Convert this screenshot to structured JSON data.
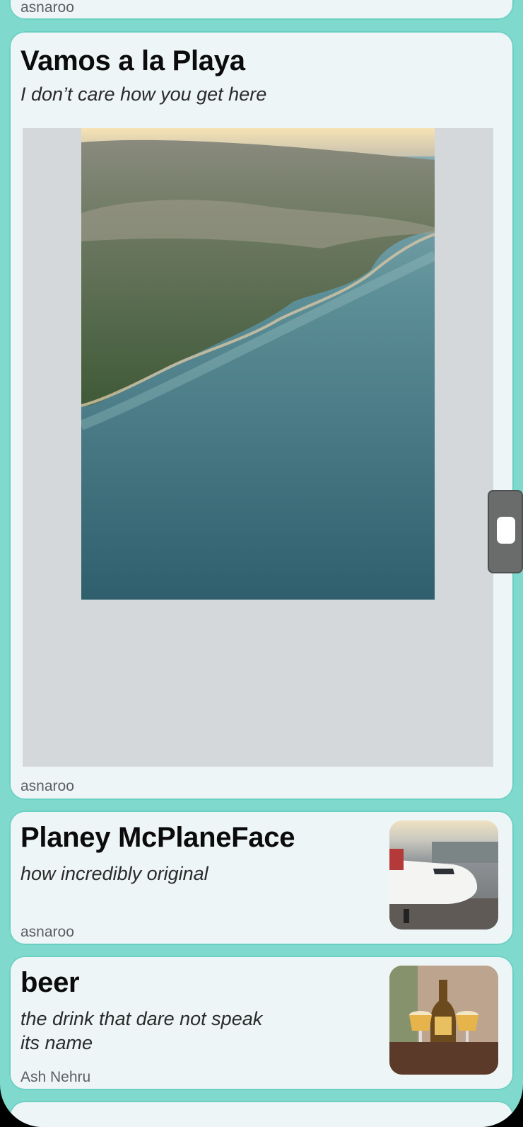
{
  "feed": {
    "prev_card": {
      "author": "asnaroo"
    },
    "cards": [
      {
        "title": "Vamos a la Playa",
        "subtitle": "I don’t care how you get here",
        "author": "asnaroo",
        "image_icon": "aerial-coastline-photo"
      },
      {
        "title": "Planey McPlaneFace",
        "subtitle": "how incredibly original",
        "author": "asnaroo",
        "image_icon": "airplane-photo"
      },
      {
        "title": "beer",
        "subtitle_line1": "the drink that dare not speak",
        "subtitle_line2": "its name",
        "author": "Ash Nehru",
        "image_icon": "beer-bottle-photo"
      }
    ]
  },
  "colors": {
    "background": "#7fd9cd",
    "card": "#eef5f7",
    "image_panel": "#d4d8db"
  }
}
